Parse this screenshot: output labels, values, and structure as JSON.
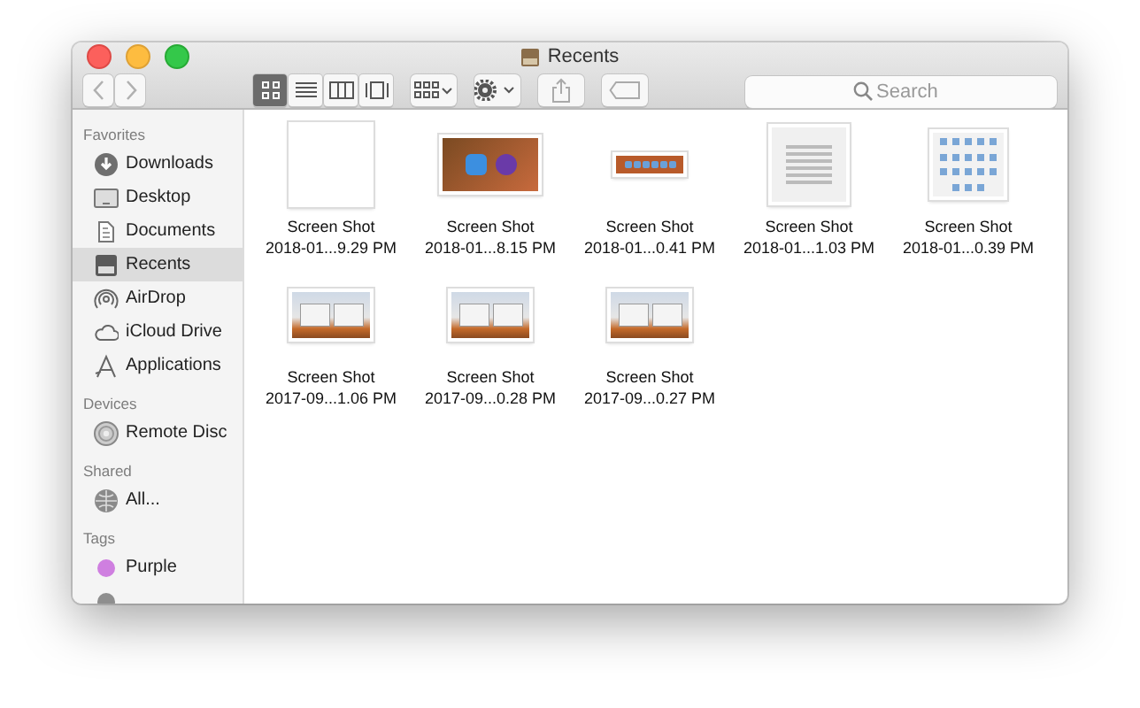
{
  "window": {
    "title": "Recents"
  },
  "toolbar": {
    "view_modes": [
      {
        "kind": "icons",
        "selected": true
      },
      {
        "kind": "list",
        "selected": false
      },
      {
        "kind": "columns",
        "selected": false
      },
      {
        "kind": "gallery",
        "selected": false
      }
    ],
    "search": {
      "placeholder": "Search"
    }
  },
  "sidebar": {
    "sections": [
      {
        "title": "Favorites",
        "items": [
          {
            "label": "Downloads",
            "kind": "download",
            "selected": false
          },
          {
            "label": "Desktop",
            "kind": "desktop",
            "selected": false
          },
          {
            "label": "Documents",
            "kind": "documents",
            "selected": false
          },
          {
            "label": "Recents",
            "kind": "recents",
            "selected": true
          },
          {
            "label": "AirDrop",
            "kind": "airdrop",
            "selected": false
          },
          {
            "label": "iCloud Drive",
            "kind": "cloud",
            "selected": false
          },
          {
            "label": "Applications",
            "kind": "apps",
            "selected": false
          }
        ]
      },
      {
        "title": "Devices",
        "items": [
          {
            "label": "Remote Disc",
            "kind": "disc",
            "selected": false
          }
        ]
      },
      {
        "title": "Shared",
        "items": [
          {
            "label": "All...",
            "kind": "network",
            "selected": false
          }
        ]
      },
      {
        "title": "Tags",
        "items": [
          {
            "label": "Purple",
            "kind": "tag",
            "color": "#cf7fe0",
            "selected": false
          },
          {
            "kind": "tag",
            "color": "#8e8e8e",
            "selected": false
          }
        ]
      }
    ]
  },
  "files": [
    {
      "name": "Screen Shot",
      "date": "2018-01...9.29 PM",
      "kind": "blank"
    },
    {
      "name": "Screen Shot",
      "date": "2018-01...8.15 PM",
      "kind": "photo"
    },
    {
      "name": "Screen Shot",
      "date": "2018-01...0.41 PM",
      "kind": "strip"
    },
    {
      "name": "Screen Shot",
      "date": "2018-01...1.03 PM",
      "kind": "doc"
    },
    {
      "name": "Screen Shot",
      "date": "2018-01...0.39 PM",
      "kind": "grid"
    },
    {
      "name": "Screen Shot",
      "date": "2017-09...1.06 PM",
      "kind": "desktop"
    },
    {
      "name": "Screen Shot",
      "date": "2017-09...0.28 PM",
      "kind": "desktop"
    },
    {
      "name": "Screen Shot",
      "date": "2017-09...0.27 PM",
      "kind": "desktop"
    }
  ]
}
